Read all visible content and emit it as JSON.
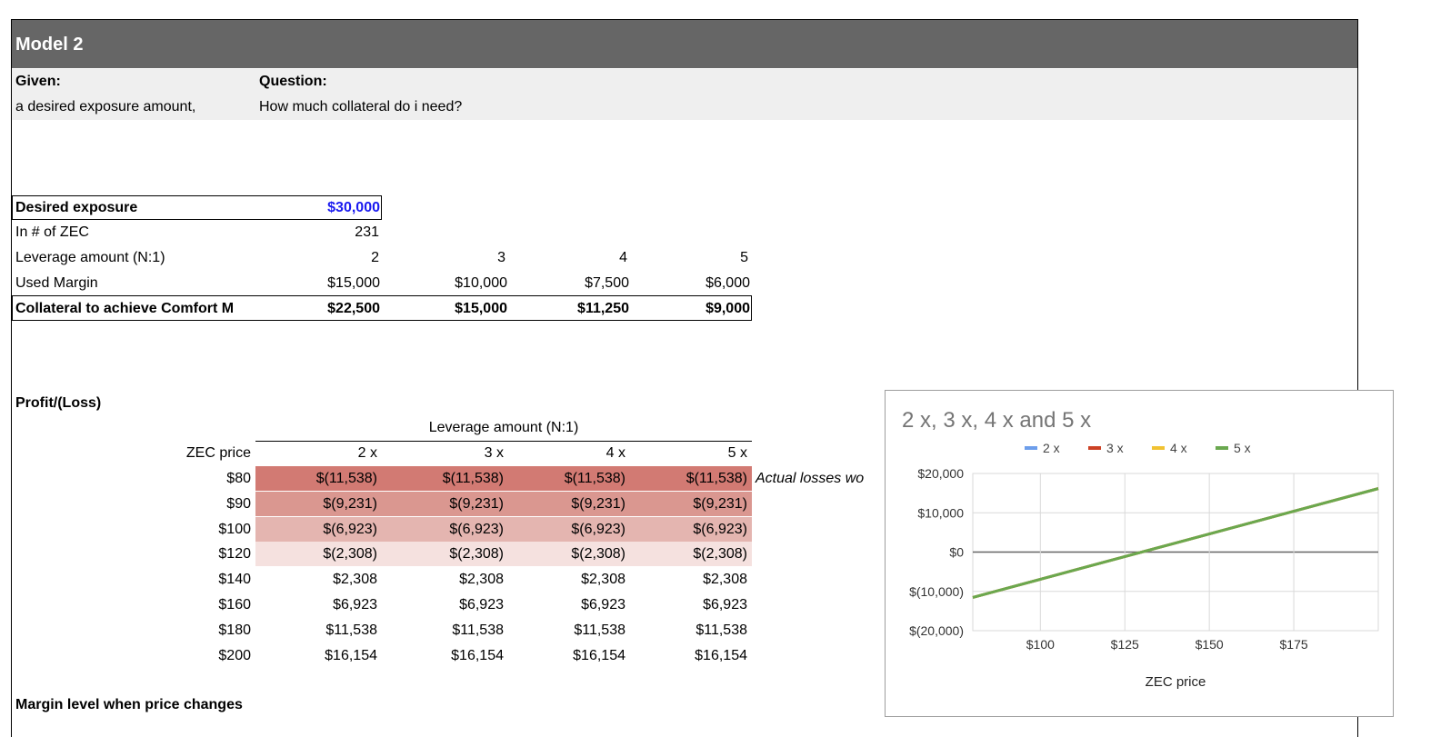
{
  "header": {
    "title": "Model 2"
  },
  "given": {
    "given_label": "Given:",
    "given_text": "a desired exposure amount,",
    "question_label": "Question:",
    "question_text": "How much collateral do i need?"
  },
  "inputs": {
    "desired_exposure_label": "Desired exposure",
    "desired_exposure_value": "$30,000",
    "zec_label": "In # of ZEC",
    "zec_value": "231",
    "leverage_label": "Leverage amount (N:1)",
    "leverage_values": [
      "2",
      "3",
      "4",
      "5"
    ],
    "used_margin_label": "Used Margin",
    "used_margin_values": [
      "$15,000",
      "$10,000",
      "$7,500",
      "$6,000"
    ],
    "collateral_label": "Collateral to achieve Comfort M",
    "collateral_values": [
      "$22,500",
      "$15,000",
      "$11,250",
      "$9,000"
    ]
  },
  "profit_loss": {
    "section_title": "Profit/(Loss)",
    "leverage_header": "Leverage amount (N:1)",
    "price_header": "ZEC price",
    "columns": [
      "2 x",
      "3 x",
      "4 x",
      "5 x"
    ],
    "note": "Actual losses wo",
    "rows": [
      {
        "price": "$80",
        "values": [
          "$(11,538)",
          "$(11,538)",
          "$(11,538)",
          "$(11,538)"
        ]
      },
      {
        "price": "$90",
        "values": [
          "$(9,231)",
          "$(9,231)",
          "$(9,231)",
          "$(9,231)"
        ]
      },
      {
        "price": "$100",
        "values": [
          "$(6,923)",
          "$(6,923)",
          "$(6,923)",
          "$(6,923)"
        ]
      },
      {
        "price": "$120",
        "values": [
          "$(2,308)",
          "$(2,308)",
          "$(2,308)",
          "$(2,308)"
        ]
      },
      {
        "price": "$140",
        "values": [
          "$2,308",
          "$2,308",
          "$2,308",
          "$2,308"
        ]
      },
      {
        "price": "$160",
        "values": [
          "$6,923",
          "$6,923",
          "$6,923",
          "$6,923"
        ]
      },
      {
        "price": "$180",
        "values": [
          "$11,538",
          "$11,538",
          "$11,538",
          "$11,538"
        ]
      },
      {
        "price": "$200",
        "values": [
          "$16,154",
          "$16,154",
          "$16,154",
          "$16,154"
        ]
      }
    ],
    "row_colors": [
      "#d27a73",
      "#da9790",
      "#e4b5b0",
      "#f5e1df",
      "#ffffff",
      "#ffffff",
      "#ffffff",
      "#ffffff"
    ]
  },
  "next_section": {
    "title": "Margin level when price changes"
  },
  "chart_data": {
    "type": "line",
    "title": "2 x, 3 x, 4 x and 5 x",
    "xlabel": "ZEC price",
    "ylabel": "",
    "x": [
      80,
      90,
      100,
      120,
      140,
      160,
      180,
      200
    ],
    "xlim": [
      80,
      200
    ],
    "ylim": [
      -20000,
      20000
    ],
    "x_ticks": [
      100,
      125,
      150,
      175
    ],
    "x_tick_labels": [
      "$100",
      "$125",
      "$150",
      "$175"
    ],
    "y_ticks": [
      20000,
      10000,
      0,
      -10000,
      -20000
    ],
    "y_tick_labels": [
      "$20,000",
      "$10,000",
      "$0",
      "$(10,000)",
      "$(20,000)"
    ],
    "legend_position": "top",
    "grid": true,
    "series": [
      {
        "name": "2 x",
        "color": "#6d9eeb",
        "values": [
          -11538,
          -9231,
          -6923,
          -2308,
          2308,
          6923,
          11538,
          16154
        ]
      },
      {
        "name": "3 x",
        "color": "#cc4125",
        "values": [
          -11538,
          -9231,
          -6923,
          -2308,
          2308,
          6923,
          11538,
          16154
        ]
      },
      {
        "name": "4 x",
        "color": "#f1c232",
        "values": [
          -11538,
          -9231,
          -6923,
          -2308,
          2308,
          6923,
          11538,
          16154
        ]
      },
      {
        "name": "5 x",
        "color": "#6aa84f",
        "values": [
          -11538,
          -9231,
          -6923,
          -2308,
          2308,
          6923,
          11538,
          16154
        ]
      }
    ]
  }
}
